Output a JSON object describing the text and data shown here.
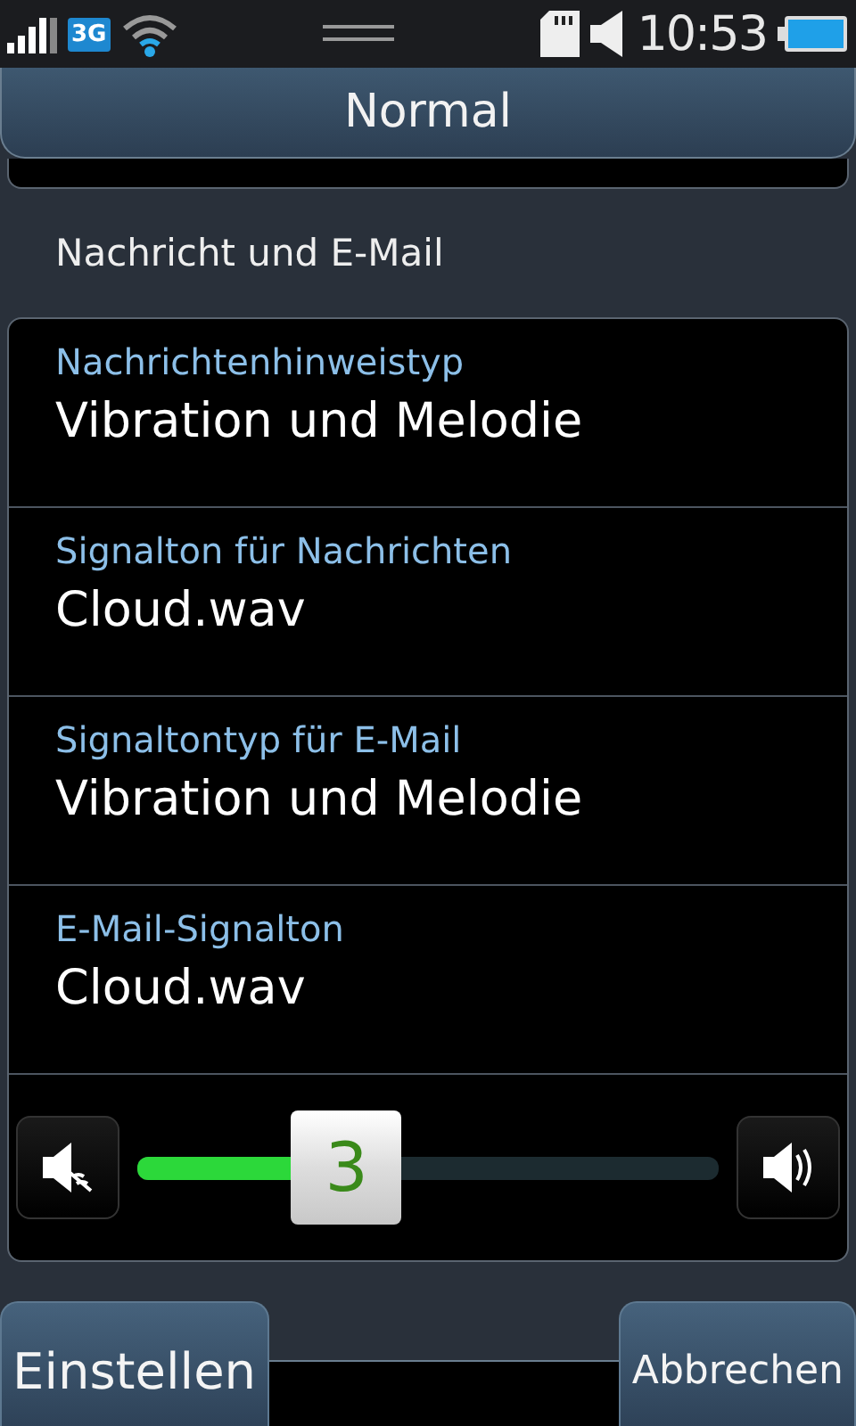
{
  "status_bar": {
    "network": "3G",
    "time": "10:53"
  },
  "header": {
    "title": "Normal"
  },
  "section": {
    "title": "Nachricht und E-Mail"
  },
  "settings": [
    {
      "label": "Nachrichtenhinweistyp",
      "value": "Vibration und Melodie"
    },
    {
      "label": "Signalton für Nachrichten",
      "value": "Cloud.wav"
    },
    {
      "label": "Signaltontyp für E-Mail",
      "value": "Vibration und Melodie"
    },
    {
      "label": "E-Mail-Signalton",
      "value": "Cloud.wav"
    }
  ],
  "volume": {
    "level": 0.36,
    "reading": "3"
  },
  "buttons": [
    {
      "label": "Einstellen"
    },
    {
      "label": "Abbrechen"
    }
  ]
}
